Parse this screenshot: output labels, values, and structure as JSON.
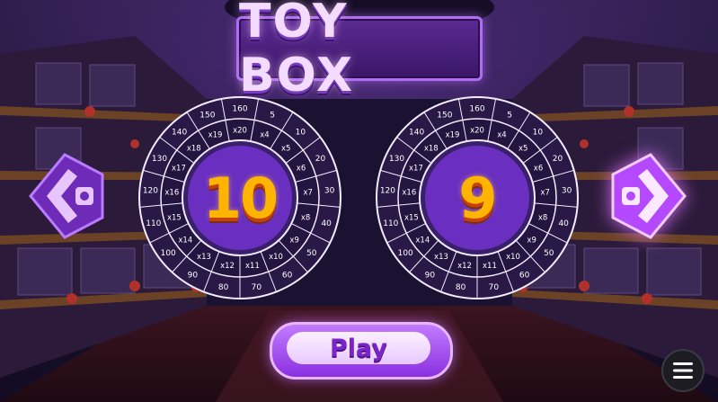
{
  "title": "TOY BOX",
  "left_dial": {
    "value": "10",
    "multipliers": [
      "x20",
      "x4",
      "x5",
      "x6",
      "x7",
      "x8",
      "x9",
      "x10",
      "x11",
      "x12",
      "x13",
      "x14",
      "x15",
      "x16",
      "x17",
      "x18",
      "x19"
    ],
    "outer": [
      "160",
      "5",
      "10",
      "20",
      "30",
      "40",
      "50",
      "60",
      "70",
      "80",
      "90",
      "100",
      "110",
      "120",
      "130",
      "140",
      "150"
    ]
  },
  "right_dial": {
    "value": "9",
    "multipliers": [
      "x20",
      "x4",
      "x5",
      "x6",
      "x7",
      "x8",
      "x9",
      "x10",
      "x11",
      "x12",
      "x13",
      "x14",
      "x15",
      "x16",
      "x17",
      "x18",
      "x19"
    ],
    "outer": [
      "160",
      "5",
      "10",
      "20",
      "30",
      "40",
      "50",
      "60",
      "70",
      "80",
      "90",
      "100",
      "110",
      "120",
      "130",
      "140",
      "150"
    ]
  },
  "play_button": {
    "label": "Play"
  },
  "icons": {
    "left_arrow": "chevron-left-icon",
    "right_arrow": "chevron-right-icon",
    "menu": "hamburger-menu-icon"
  },
  "colors": {
    "accent_purple": "#9b3df2",
    "number_gold": "#ffb400",
    "dial_center": "#6a2fc0"
  }
}
